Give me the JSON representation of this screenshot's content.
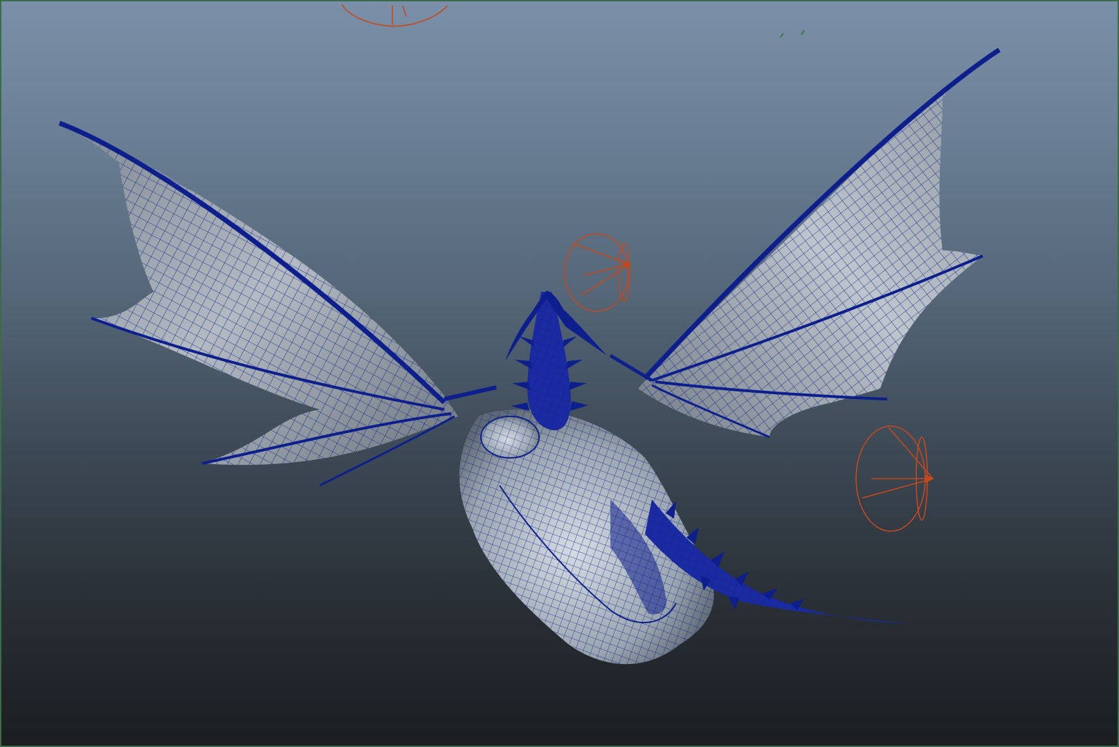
{
  "viewport": {
    "name": "3d-viewport",
    "background_top": "#7a90a8",
    "background_bottom": "#1b1d21",
    "border_color": "#3b6b4a"
  },
  "scene": {
    "model": "winged-dragon-mesh",
    "wireframe_color": "#0d1f8c",
    "surface_color": "#a9b3bd",
    "light_gizmo_color": "#c4491e",
    "light_gizmos": [
      "spot-light-top",
      "spot-light-center",
      "spot-light-right"
    ],
    "locator_color": "#2e7a3c"
  }
}
